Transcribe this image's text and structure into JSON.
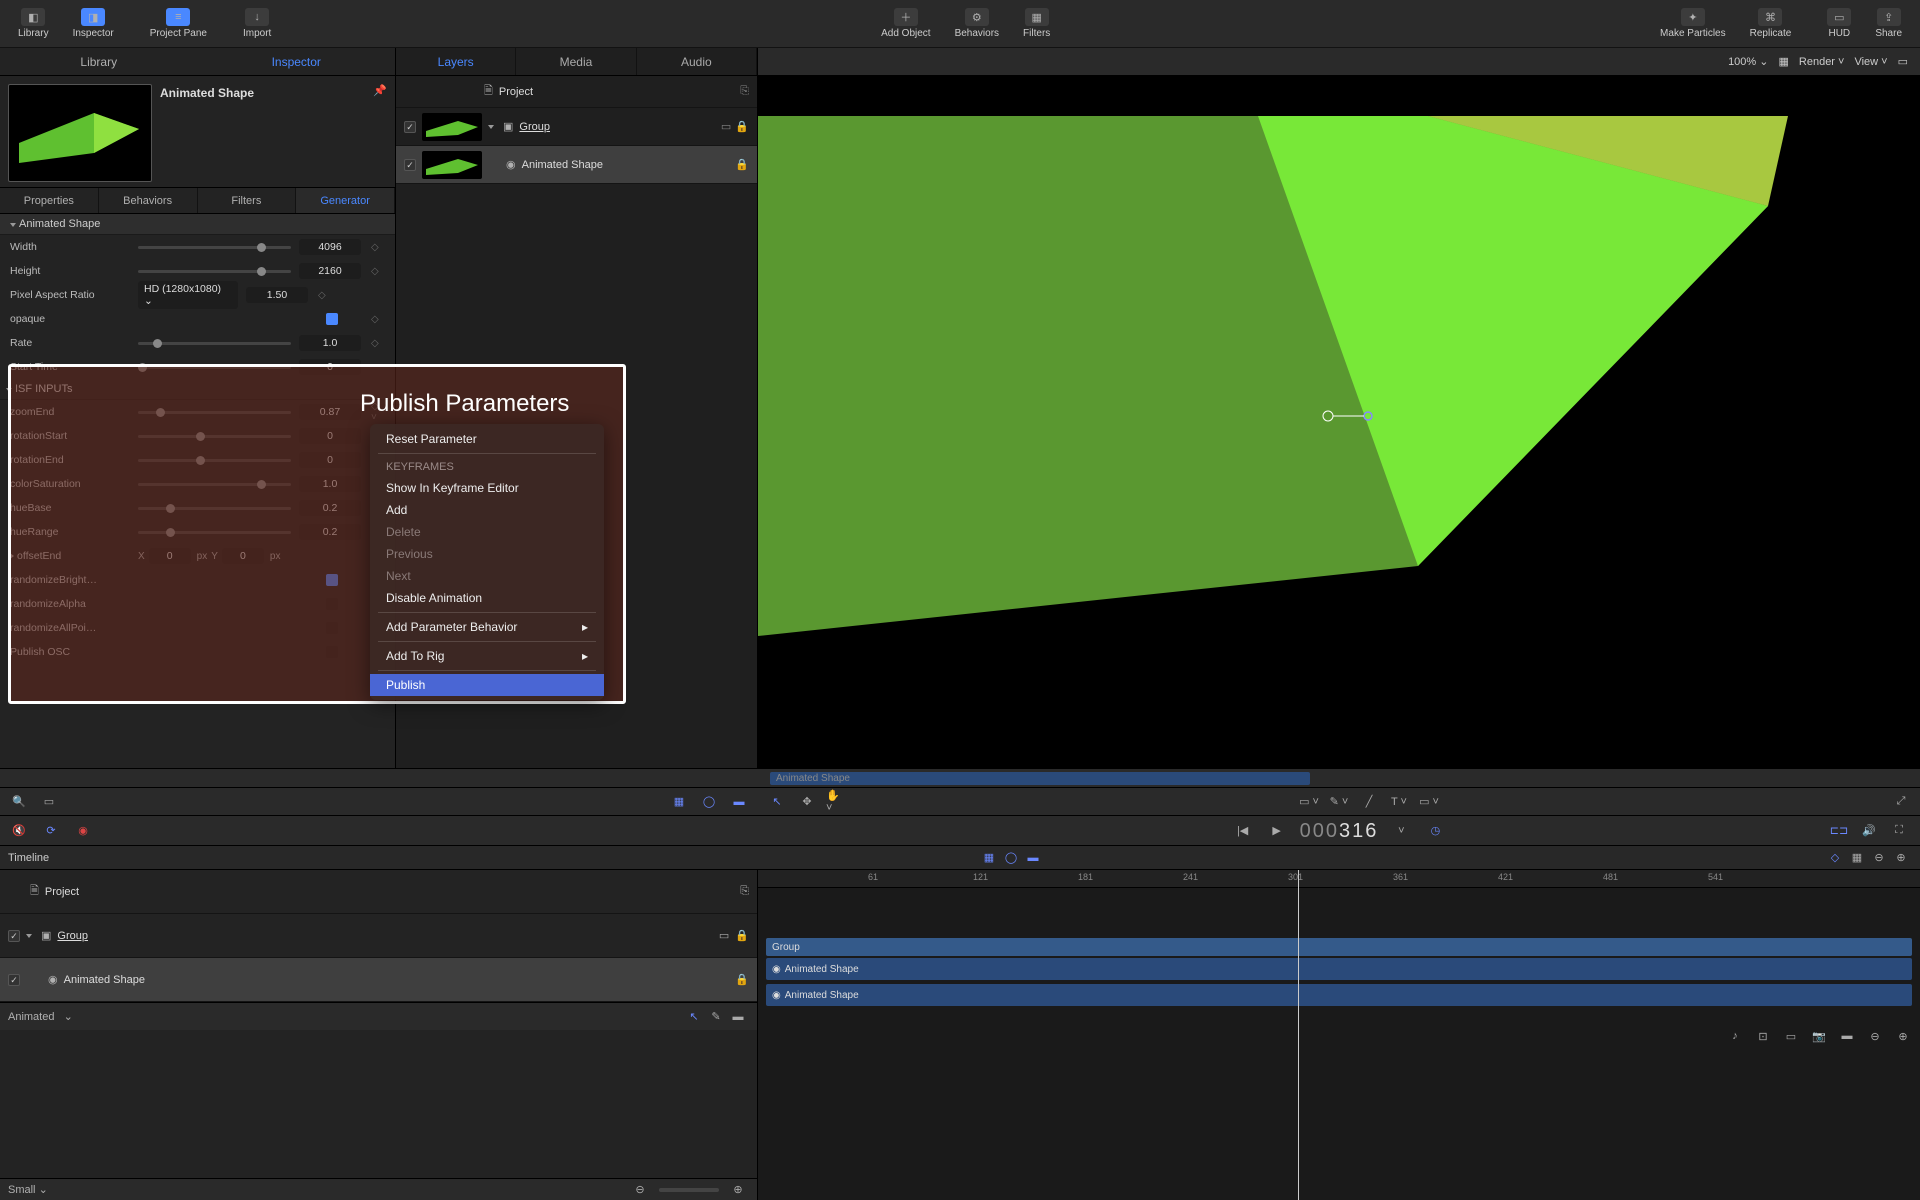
{
  "toolbar": {
    "library": "Library",
    "inspector": "Inspector",
    "project_pane": "Project Pane",
    "import": "Import",
    "add_object": "Add Object",
    "behaviors": "Behaviors",
    "filters": "Filters",
    "make_particles": "Make Particles",
    "replicate": "Replicate",
    "hud": "HUD",
    "share": "Share"
  },
  "lefttabs": {
    "library": "Library",
    "inspector": "Inspector"
  },
  "preview": {
    "title": "Animated Shape"
  },
  "inspector_tabs": {
    "properties": "Properties",
    "behaviors": "Behaviors",
    "filters": "Filters",
    "generator": "Generator"
  },
  "param_header": "Animated Shape",
  "params": {
    "width": {
      "label": "Width",
      "value": "4096"
    },
    "height": {
      "label": "Height",
      "value": "2160"
    },
    "par": {
      "label": "Pixel Aspect Ratio",
      "drop": "HD (1280x1080)",
      "value": "1.50"
    },
    "opaque": {
      "label": "opaque"
    },
    "rate": {
      "label": "Rate",
      "value": "1.0"
    },
    "start_time": {
      "label": "Start Time",
      "value": "0"
    },
    "isf": {
      "label": "ISF INPUTs"
    },
    "zoom_end": {
      "label": "zoomEnd",
      "value": "0.87"
    },
    "rotation_start": {
      "label": "rotationStart",
      "value": "0"
    },
    "rotation_end": {
      "label": "rotationEnd",
      "value": "0"
    },
    "color_sat": {
      "label": "colorSaturation",
      "value": "1.0"
    },
    "hue_base": {
      "label": "hueBase",
      "value": "0.2"
    },
    "hue_range": {
      "label": "hueRange",
      "value": "0.2"
    },
    "offset_end": {
      "label": "offsetEnd",
      "x": "X",
      "xv": "0",
      "xunit": "px",
      "y": "Y",
      "yv": "0",
      "yunit": "px"
    },
    "rand_bright": {
      "label": "randomizeBright…"
    },
    "rand_alpha": {
      "label": "randomizeAlpha"
    },
    "rand_all": {
      "label": "randomizeAllPoi…"
    },
    "publish_osc": {
      "label": "Publish OSC"
    }
  },
  "midtabs": {
    "layers": "Layers",
    "media": "Media",
    "audio": "Audio"
  },
  "layers": {
    "project": "Project",
    "group": "Group",
    "animated_shape": "Animated Shape"
  },
  "viewer": {
    "zoom": "100%",
    "render": "Render",
    "view": "View"
  },
  "overlay_title": "Publish Parameters",
  "ctxmenu": {
    "reset": "Reset Parameter",
    "keyframes": "KEYFRAMES",
    "show_kf": "Show In Keyframe Editor",
    "add": "Add",
    "delete": "Delete",
    "previous": "Previous",
    "next": "Next",
    "disable": "Disable Animation",
    "add_behavior": "Add Parameter Behavior",
    "add_rig": "Add To Rig",
    "publish": "Publish"
  },
  "timeline": {
    "label": "Timeline",
    "project": "Project",
    "group": "Group",
    "animated_shape": "Animated Shape",
    "clip_label": "Animated Shape",
    "animated_drop": "Animated",
    "small": "Small"
  },
  "timecode": {
    "dim": "000",
    "bright": "316"
  },
  "ruler_ticks": [
    "61",
    "121",
    "181",
    "241",
    "301",
    "361",
    "421",
    "481",
    "541"
  ],
  "track_group": "Group",
  "track_shape": "Animated Shape"
}
